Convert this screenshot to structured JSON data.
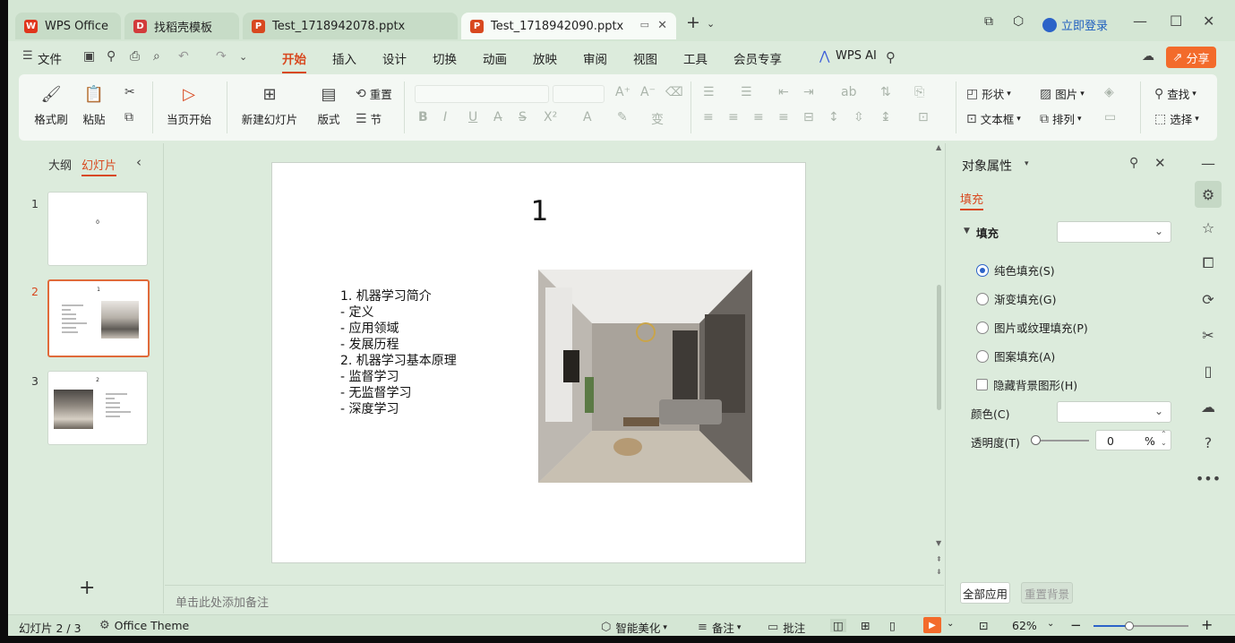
{
  "window": {
    "tabs": [
      {
        "label": "WPS Office",
        "icon": "wps-logo-icon",
        "color": "#e0351c"
      },
      {
        "label": "找稻壳模板",
        "icon": "docer-icon",
        "color": "#d23b3b"
      },
      {
        "label": "Test_1718942078.pptx",
        "icon": "ppt-file-icon",
        "color": "#d8481f"
      },
      {
        "label": "Test_1718942090.pptx",
        "icon": "ppt-file-icon",
        "color": "#d8481f",
        "active": true
      }
    ],
    "login_label": "立即登录"
  },
  "menu": {
    "file_label": "文件",
    "tabs": [
      "开始",
      "插入",
      "设计",
      "切换",
      "动画",
      "放映",
      "审阅",
      "视图",
      "工具",
      "会员专享"
    ],
    "active_tab": "开始",
    "ai_label": "WPS AI",
    "share_label": "分享"
  },
  "ribbon": {
    "format_painter": "格式刷",
    "paste": "粘贴",
    "play_from_current": "当页开始",
    "new_slide": "新建幻灯片",
    "layout": "版式",
    "reset": "重置",
    "section": "节",
    "shape": "形状",
    "picture": "图片",
    "textbox": "文本框",
    "arrange": "排列",
    "find": "查找",
    "select": "选择"
  },
  "left_panel": {
    "tab_outline": "大纲",
    "tab_slides": "幻灯片",
    "slides": [
      {
        "num": "1",
        "title": "0"
      },
      {
        "num": "2",
        "title": "1",
        "active": true
      },
      {
        "num": "3",
        "title": "2"
      }
    ]
  },
  "slide": {
    "title": "1",
    "bullets": [
      "1. 机器学习简介",
      "- 定义",
      "- 应用领域",
      "- 发展历程",
      "2. 机器学习基本原理",
      "- 监督学习",
      "- 无监督学习",
      "- 深度学习"
    ]
  },
  "notes_placeholder": "单击此处添加备注",
  "properties": {
    "title": "对象属性",
    "section_tab": "填充",
    "fill_label": "填充",
    "options": [
      {
        "label": "纯色填充(S)",
        "selected": true
      },
      {
        "label": "渐变填充(G)",
        "selected": false
      },
      {
        "label": "图片或纹理填充(P)",
        "selected": false
      },
      {
        "label": "图案填充(A)",
        "selected": false
      }
    ],
    "hide_bg_label": "隐藏背景图形(H)",
    "color_label": "颜色(C)",
    "transparency_label": "透明度(T)",
    "transparency_value": "0",
    "transparency_unit": "%",
    "apply_all": "全部应用",
    "reset_bg": "重置背景"
  },
  "statusbar": {
    "slide_counter": "幻灯片 2 / 3",
    "theme": "Office Theme",
    "beautify": "智能美化",
    "notes": "备注",
    "comments": "批注",
    "zoom": "62%",
    "zoom_level": 0.38
  }
}
